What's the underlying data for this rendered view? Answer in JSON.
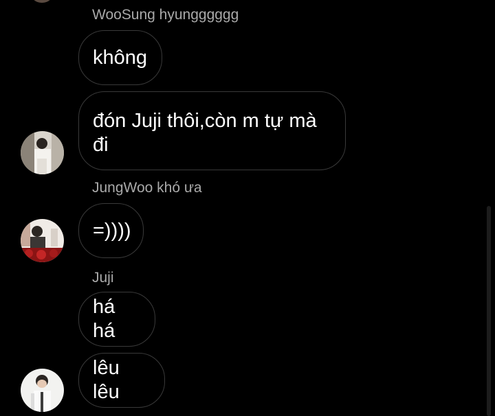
{
  "chat": {
    "messages": [
      {
        "sender": "WooSung hyungggggg",
        "text": "không"
      },
      {
        "sender": "",
        "text": "đón Juji thôi,còn m tự mà đi"
      },
      {
        "sender": "JungWoo khó ưa",
        "text": "=))))"
      },
      {
        "sender": "Juji",
        "text": "há há"
      },
      {
        "sender": "",
        "text": "lêu lêu"
      }
    ]
  },
  "colors": {
    "background": "#000000",
    "bubble_border": "#3a3a3a",
    "sender_text": "#a9a9a9",
    "message_text": "#ffffff"
  },
  "icons": [
    "avatar-woosung",
    "avatar-jungwoo",
    "avatar-juji"
  ]
}
